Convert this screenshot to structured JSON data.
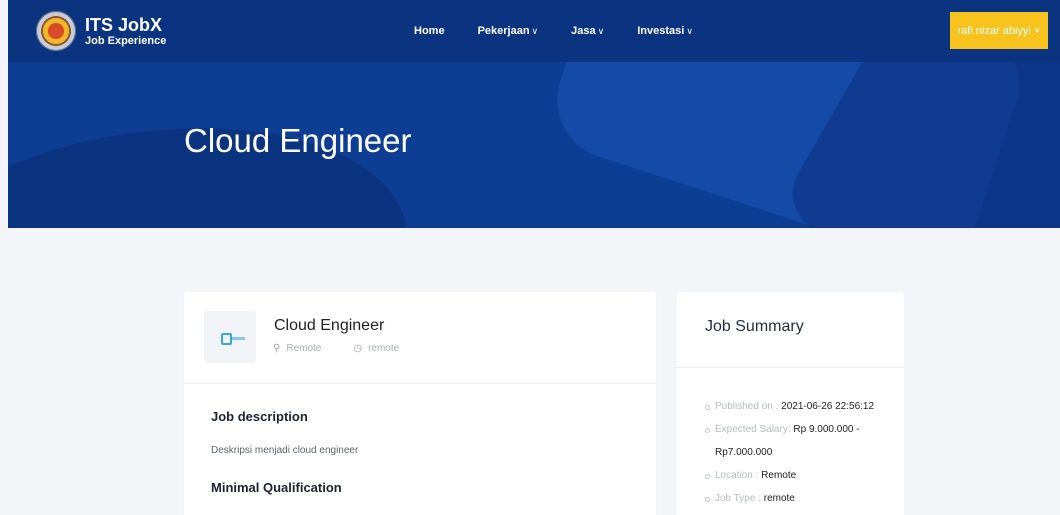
{
  "brand": {
    "name": "ITS JobX",
    "subtitle": "Job Experience",
    "logo_icon": "university-seal-icon"
  },
  "nav": {
    "items": [
      {
        "label": "Home",
        "has_dropdown": false
      },
      {
        "label": "Pekerjaan",
        "has_dropdown": true
      },
      {
        "label": "Jasa",
        "has_dropdown": true
      },
      {
        "label": "Investasi",
        "has_dropdown": true
      }
    ],
    "dropdown_icon": "chevron-down-icon"
  },
  "user_menu": {
    "label": "rafi nizar abiyyi",
    "color": "#f7c31c"
  },
  "hero": {
    "title": "Cloud Engineer",
    "background": "#0e3d94"
  },
  "job": {
    "title": "Cloud Engineer",
    "location": "Remote",
    "job_type": "remote",
    "location_icon": "map-pin-icon",
    "type_icon": "clock-icon"
  },
  "sections": {
    "description_title": "Job description",
    "description_text": "Deskripsi menjadi cloud engineer",
    "qualification_title": "Minimal Qualification"
  },
  "summary": {
    "title": "Job Summary",
    "published_label": "Published on :",
    "published_value": "2021-06-26 22:56:12",
    "salary_label": "Expected Salary:",
    "salary_value": "Rp 9.000.000 - Rp7.000.000",
    "location_label": "Location :",
    "location_value": "Remote",
    "type_label": "Job Type :",
    "type_value": "remote"
  },
  "colors": {
    "navbar": "#0b3480",
    "accent": "#f7c31c",
    "page_bg": "#f4f5f8"
  }
}
